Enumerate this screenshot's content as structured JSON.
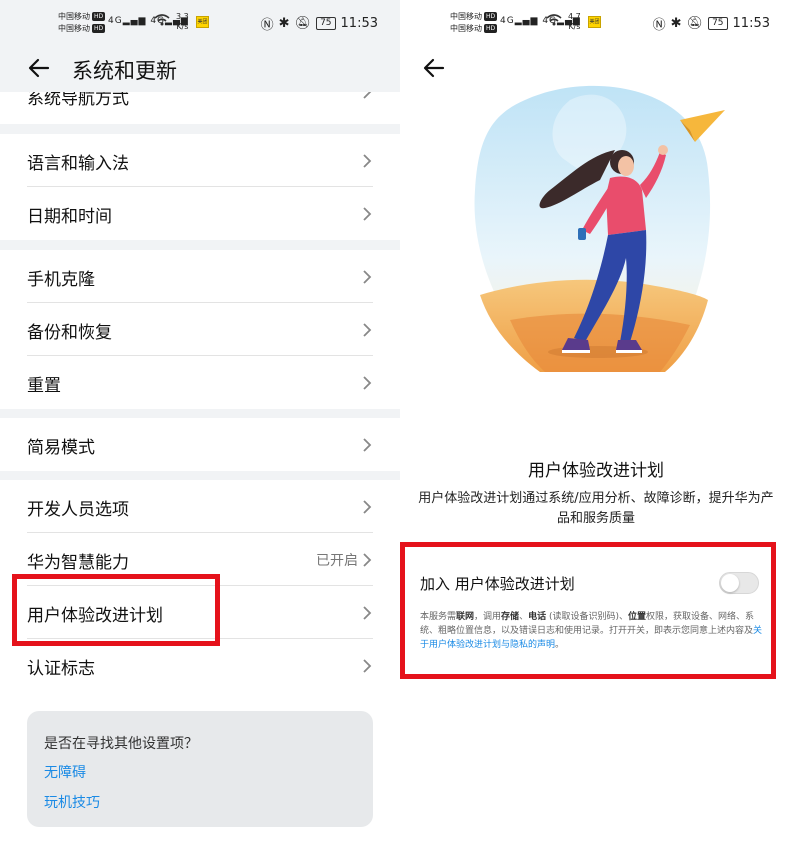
{
  "status_bar": {
    "carrier_1": "中国移动",
    "carrier_2": "中国移动",
    "hd_badge": "HD",
    "network": "4G",
    "speed_left": "3.3",
    "speed_right": "4.7",
    "speed_unit": "K/s",
    "app_icon_label": "美团",
    "battery": "75",
    "time": "11:53"
  },
  "left_screen": {
    "header": {
      "title": "系统和更新"
    },
    "partial_item": {
      "label": "系统导航方式"
    },
    "groups": [
      {
        "items": [
          {
            "label": "语言和输入法"
          },
          {
            "label": "日期和时间"
          }
        ]
      },
      {
        "items": [
          {
            "label": "手机克隆"
          },
          {
            "label": "备份和恢复"
          },
          {
            "label": "重置"
          }
        ]
      },
      {
        "items": [
          {
            "label": "简易模式"
          }
        ]
      },
      {
        "items": [
          {
            "label": "开发人员选项"
          },
          {
            "label": "华为智慧能力",
            "value": "已开启"
          },
          {
            "label": "用户体验改进计划"
          },
          {
            "label": "认证标志"
          }
        ]
      }
    ],
    "suggestion_card": {
      "question": "是否在寻找其他设置项？",
      "links": [
        "无障碍",
        "玩机技巧"
      ]
    }
  },
  "right_screen": {
    "title": "用户体验改进计划",
    "description": "用户体验改进计划通过系统/应用分析、故障诊断，提升华为产品和服务质量",
    "join_label": "加入 用户体验改进计划",
    "toggle_on": false,
    "notice": {
      "p1": "本服务需",
      "b1": "联网",
      "p2": "，调用",
      "b2": "存储",
      "p3": "、",
      "b3": "电话",
      "p4": " (读取设备识别码)、",
      "b4": "位置",
      "p5": "权限，获取设备、网络、系统、粗略位置信息，以及错误日志和使用记录。打开开关，即表示您同意上述内容及",
      "link": "关于用户体验改进计划与隐私的声明",
      "p6": "。"
    }
  },
  "colors": {
    "highlight_box": "#e5121b",
    "link": "#1a8ae5",
    "group_gap": "#f1f3f5"
  },
  "icons": [
    "back-arrow-icon",
    "chevron-right-icon",
    "nfc-icon",
    "bluetooth-icon",
    "mute-icon",
    "wifi-icon",
    "signal-icon",
    "battery-icon"
  ]
}
